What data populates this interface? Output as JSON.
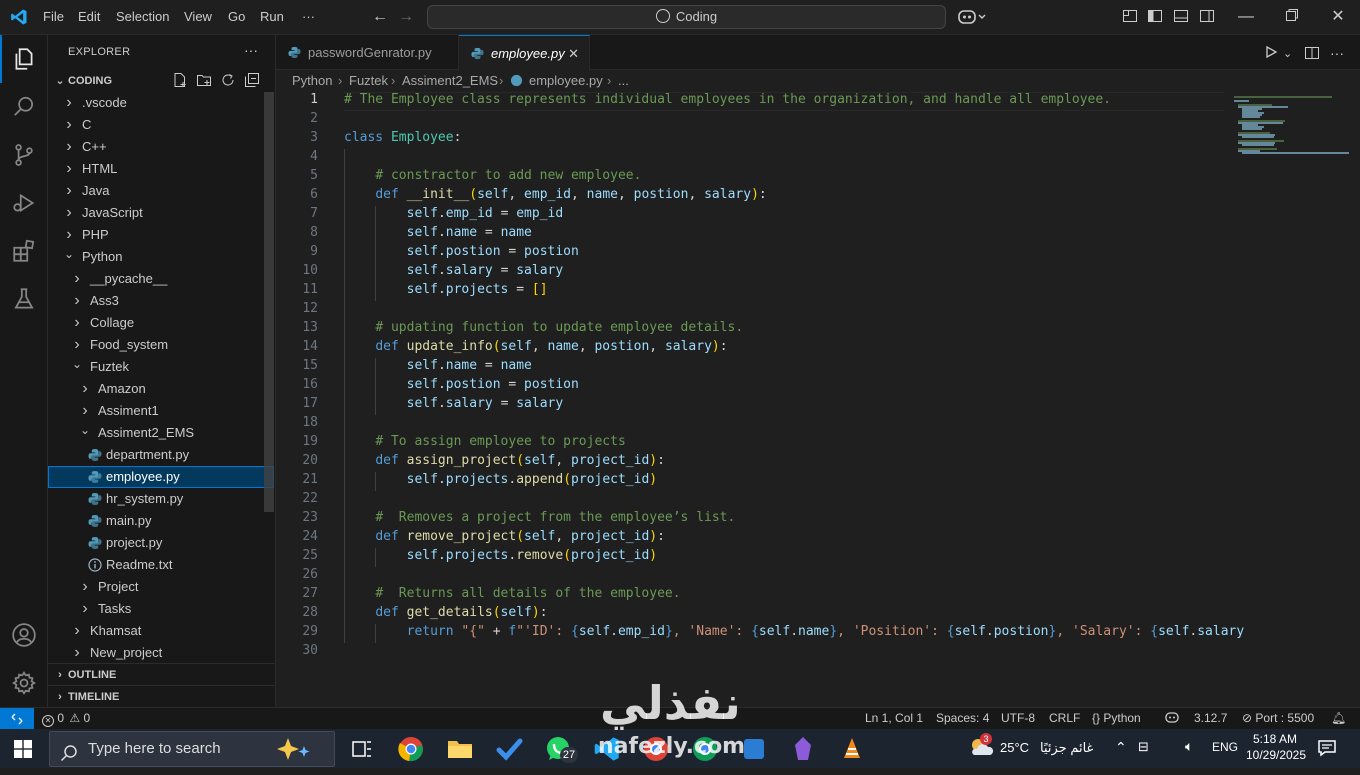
{
  "titlebar": {
    "menu": [
      "File",
      "Edit",
      "Selection",
      "View",
      "Go",
      "Run",
      "···"
    ],
    "search_label": "Coding"
  },
  "explorer": {
    "title": "EXPLORER",
    "more": "···",
    "workspace": "CODING",
    "tree": [
      {
        "label": ".vscode",
        "type": "folder",
        "open": false,
        "depth": 0
      },
      {
        "label": "C",
        "type": "folder",
        "open": false,
        "depth": 0
      },
      {
        "label": "C++",
        "type": "folder",
        "open": false,
        "depth": 0
      },
      {
        "label": "HTML",
        "type": "folder",
        "open": false,
        "depth": 0
      },
      {
        "label": "Java",
        "type": "folder",
        "open": false,
        "depth": 0
      },
      {
        "label": "JavaScript",
        "type": "folder",
        "open": false,
        "depth": 0
      },
      {
        "label": "PHP",
        "type": "folder",
        "open": false,
        "depth": 0
      },
      {
        "label": "Python",
        "type": "folder",
        "open": true,
        "depth": 0
      },
      {
        "label": "__pycache__",
        "type": "folder",
        "open": false,
        "depth": 1
      },
      {
        "label": "Ass3",
        "type": "folder",
        "open": false,
        "depth": 1
      },
      {
        "label": "Collage",
        "type": "folder",
        "open": false,
        "depth": 1
      },
      {
        "label": "Food_system",
        "type": "folder",
        "open": false,
        "depth": 1
      },
      {
        "label": "Fuztek",
        "type": "folder",
        "open": true,
        "depth": 1
      },
      {
        "label": "Amazon",
        "type": "folder",
        "open": false,
        "depth": 2
      },
      {
        "label": "Assiment1",
        "type": "folder",
        "open": false,
        "depth": 2
      },
      {
        "label": "Assiment2_EMS",
        "type": "folder",
        "open": true,
        "depth": 2
      },
      {
        "label": "department.py",
        "type": "py",
        "depth": 3
      },
      {
        "label": "employee.py",
        "type": "py",
        "depth": 3,
        "selected": true
      },
      {
        "label": "hr_system.py",
        "type": "py",
        "depth": 3
      },
      {
        "label": "main.py",
        "type": "py",
        "depth": 3
      },
      {
        "label": "project.py",
        "type": "py",
        "depth": 3
      },
      {
        "label": "Readme.txt",
        "type": "txt",
        "depth": 3
      },
      {
        "label": "Project",
        "type": "folder",
        "open": false,
        "depth": 2
      },
      {
        "label": "Tasks",
        "type": "folder",
        "open": false,
        "depth": 2
      },
      {
        "label": "Khamsat",
        "type": "folder",
        "open": false,
        "depth": 1
      },
      {
        "label": "New_project",
        "type": "folder",
        "open": false,
        "depth": 1
      }
    ],
    "outline": "OUTLINE",
    "timeline": "TIMELINE"
  },
  "tabs": [
    {
      "label": "passwordGenrator.py",
      "active": false
    },
    {
      "label": "employee.py",
      "active": true,
      "close": "✕"
    }
  ],
  "breadcrumb": [
    "Python",
    "Fuztek",
    "Assiment2_EMS",
    "employee.py",
    "..."
  ],
  "editor": {
    "current_line": 1,
    "lines": [
      "# The Employee class represents individual employees in the organization, and handle all employee.",
      "",
      "class Employee:",
      "",
      "    # constractor to add new employee.",
      "    def __init__(self, emp_id, name, postion, salary):",
      "        self.emp_id = emp_id",
      "        self.name = name",
      "        self.postion = postion",
      "        self.salary = salary",
      "        self.projects = []",
      "",
      "    # updating function to update employee details.",
      "    def update_info(self, name, postion, salary):",
      "        self.name = name",
      "        self.postion = postion",
      "        self.salary = salary",
      "",
      "    # To assign employee to projects",
      "    def assign_project(self, project_id):",
      "        self.projects.append(project_id)",
      "",
      "    #  Removes a project from the employee’s list.",
      "    def remove_project(self, project_id):",
      "        self.projects.remove(project_id)",
      "",
      "    #  Returns all details of the employee.",
      "    def get_details(self):",
      "        return \"{\" + f\"'ID': {self.emp_id}, 'Name': {self.name}, 'Position': {self.postion}, 'Salary': {self.salary",
      ""
    ]
  },
  "status": {
    "problems_errors": "0",
    "problems_warnings": "0",
    "cursor": "Ln 1, Col 1",
    "spaces": "Spaces: 4",
    "encoding": "UTF-8",
    "eol": "CRLF",
    "language": "Python",
    "python_version": "3.12.7",
    "port": "Port : 5500"
  },
  "taskbar": {
    "search_placeholder": "Type here to search",
    "weather_temp": "25°C",
    "weather_text": "غائم جزئيًا",
    "weather_badge": "3",
    "lang": "ENG",
    "time": "5:18 AM",
    "date": "10/29/2025",
    "whatsapp_badge": "27"
  },
  "watermark": {
    "arabic": "نفذلي",
    "latin": "nafezly.com"
  },
  "colors": {
    "accent": "#0078d4",
    "background": "#1f1f1f",
    "sidebar": "#181818",
    "comment": "#6a9955",
    "keyword": "#569cd6"
  }
}
